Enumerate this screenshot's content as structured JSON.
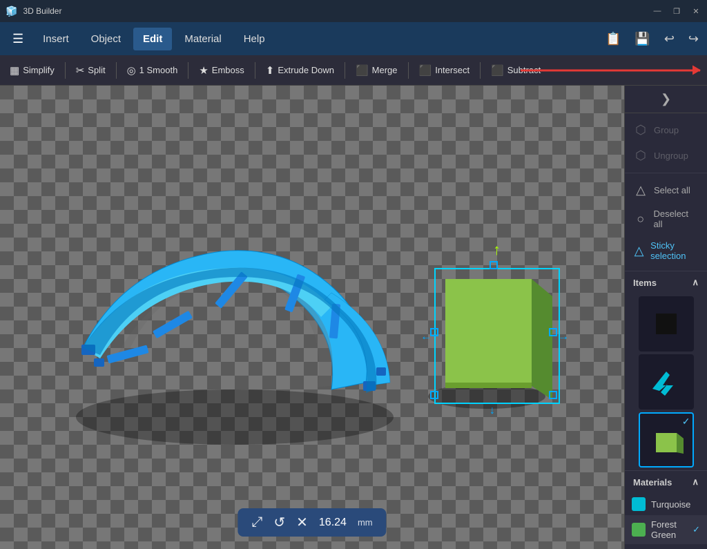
{
  "app": {
    "title": "3D Builder",
    "window_controls": [
      "minimize",
      "restore",
      "close"
    ]
  },
  "titlebar": {
    "title": "3D Builder",
    "minimize": "—",
    "restore": "❐",
    "close": "✕"
  },
  "menubar": {
    "items": [
      "Insert",
      "Object",
      "Edit",
      "Material",
      "Help"
    ],
    "active": "Edit",
    "icons_right": [
      "💾",
      "↩",
      "↪"
    ]
  },
  "toolbar": {
    "buttons": [
      {
        "id": "simplify",
        "icon": "▦",
        "label": "Simplify"
      },
      {
        "id": "split",
        "icon": "✂",
        "label": "Split"
      },
      {
        "id": "smooth",
        "icon": "◎",
        "label": "1 Smooth"
      },
      {
        "id": "emboss",
        "icon": "★",
        "label": "Emboss"
      },
      {
        "id": "extrude",
        "icon": "⬆",
        "label": "Extrude Down"
      },
      {
        "id": "merge",
        "icon": "⬛",
        "label": "Merge"
      },
      {
        "id": "intersect",
        "icon": "⬛",
        "label": "Intersect"
      },
      {
        "id": "subtract",
        "icon": "⬛",
        "label": "Subtract"
      }
    ]
  },
  "right_panel": {
    "collapse_icon": "❯",
    "group_label": "Group",
    "ungroup_label": "Ungroup",
    "select_all_label": "Select all",
    "deselect_all_label": "Deselect all",
    "sticky_selection_label": "Sticky selection",
    "items_label": "Items",
    "materials_label": "Materials",
    "items": [
      {
        "id": "black-square",
        "type": "black"
      },
      {
        "id": "cyan-shape",
        "type": "cyan"
      },
      {
        "id": "green-cube",
        "type": "green",
        "selected": true
      }
    ],
    "materials": [
      {
        "id": "turquoise",
        "label": "Turquoise",
        "color": "#00bcd4"
      },
      {
        "id": "forest-green",
        "label": "Forest Green",
        "color": "#4caf50",
        "selected": true
      }
    ]
  },
  "measurement": {
    "value": "16.24",
    "unit": "mm",
    "icons": [
      "⤢",
      "↺",
      "✕"
    ]
  },
  "colors": {
    "accent_blue": "#00aaff",
    "active_blue": "#4fc3f7",
    "turquoise": "#00bcd4",
    "forest_green": "#4caf50",
    "red_arrow": "#e53935"
  }
}
